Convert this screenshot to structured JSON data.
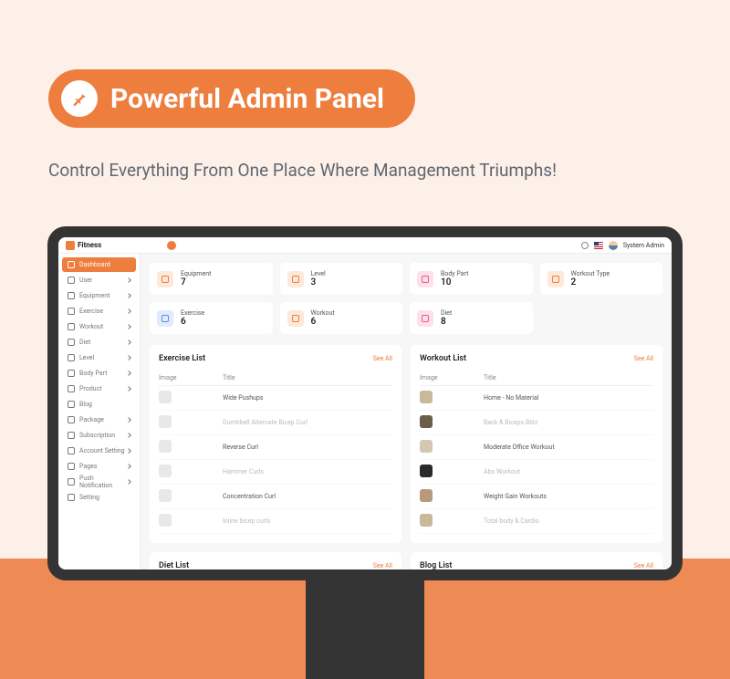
{
  "hero": {
    "title": "Powerful Admin Panel"
  },
  "subtitle": "Control Everything From One Place Where Management Triumphs!",
  "logo": "Fitness",
  "user": "System Admin",
  "sidebar": [
    {
      "label": "Dashboard",
      "icon": "dashboard-icon",
      "active": true,
      "chevron": false
    },
    {
      "label": "User",
      "icon": "user-icon",
      "active": false,
      "chevron": true
    },
    {
      "label": "Equipment",
      "icon": "equipment-icon",
      "active": false,
      "chevron": true
    },
    {
      "label": "Exercise",
      "icon": "exercise-icon",
      "active": false,
      "chevron": true
    },
    {
      "label": "Workout",
      "icon": "workout-icon",
      "active": false,
      "chevron": true
    },
    {
      "label": "Diet",
      "icon": "diet-icon",
      "active": false,
      "chevron": true
    },
    {
      "label": "Level",
      "icon": "level-icon",
      "active": false,
      "chevron": true
    },
    {
      "label": "Body Part",
      "icon": "bodypart-icon",
      "active": false,
      "chevron": true
    },
    {
      "label": "Product",
      "icon": "product-icon",
      "active": false,
      "chevron": true
    },
    {
      "label": "Blog",
      "icon": "blog-icon",
      "active": false,
      "chevron": false
    },
    {
      "label": "Package",
      "icon": "package-icon",
      "active": false,
      "chevron": true
    },
    {
      "label": "Subscription",
      "icon": "subscription-icon",
      "active": false,
      "chevron": true
    },
    {
      "label": "Account Setting",
      "icon": "account-icon",
      "active": false,
      "chevron": true
    },
    {
      "label": "Pages",
      "icon": "pages-icon",
      "active": false,
      "chevron": true
    },
    {
      "label": "Push Notification",
      "icon": "notification-icon",
      "active": false,
      "chevron": true
    },
    {
      "label": "Setting",
      "icon": "setting-icon",
      "active": false,
      "chevron": false
    }
  ],
  "stats_row1": [
    {
      "label": "Equipment",
      "value": "7",
      "icon": "equipment-icon",
      "color": "orange"
    },
    {
      "label": "Level",
      "value": "3",
      "icon": "level-icon",
      "color": "orange"
    },
    {
      "label": "Body Part",
      "value": "10",
      "icon": "bodypart-icon",
      "color": "pink"
    },
    {
      "label": "Workout Type",
      "value": "2",
      "icon": "workouttype-icon",
      "color": "orange"
    }
  ],
  "stats_row2": [
    {
      "label": "Exercise",
      "value": "6",
      "icon": "exercise-icon",
      "color": "blue"
    },
    {
      "label": "Workout",
      "value": "6",
      "icon": "workout-icon",
      "color": "orange"
    },
    {
      "label": "Diet",
      "value": "8",
      "icon": "diet-icon",
      "color": "pink"
    }
  ],
  "exercise_list": {
    "title": "Exercise List",
    "see_all": "See All",
    "headers": {
      "image": "Image",
      "title": "Title"
    },
    "rows": [
      {
        "title": "Wide Pushups",
        "muted": false
      },
      {
        "title": "Dumbbell Alternate Bicep Curl",
        "muted": true
      },
      {
        "title": "Reverse Curl",
        "muted": false
      },
      {
        "title": "Hammer Curls",
        "muted": true
      },
      {
        "title": "Concentration Curl",
        "muted": false
      },
      {
        "title": "Inline bicep curls",
        "muted": true
      }
    ]
  },
  "workout_list": {
    "title": "Workout List",
    "see_all": "See All",
    "headers": {
      "image": "Image",
      "title": "Title"
    },
    "rows": [
      {
        "title": "Home - No Material",
        "muted": false
      },
      {
        "title": "Back & Biceps Blitz",
        "muted": true
      },
      {
        "title": "Moderate Office Workout",
        "muted": false
      },
      {
        "title": "Abs Workout",
        "muted": true
      },
      {
        "title": "Weight Gain Workouts",
        "muted": false
      },
      {
        "title": "Total body & Cardio",
        "muted": true
      }
    ]
  },
  "diet_list": {
    "title": "Diet List",
    "see_all": "See All"
  },
  "blog_list": {
    "title": "Blog List",
    "see_all": "See All"
  }
}
